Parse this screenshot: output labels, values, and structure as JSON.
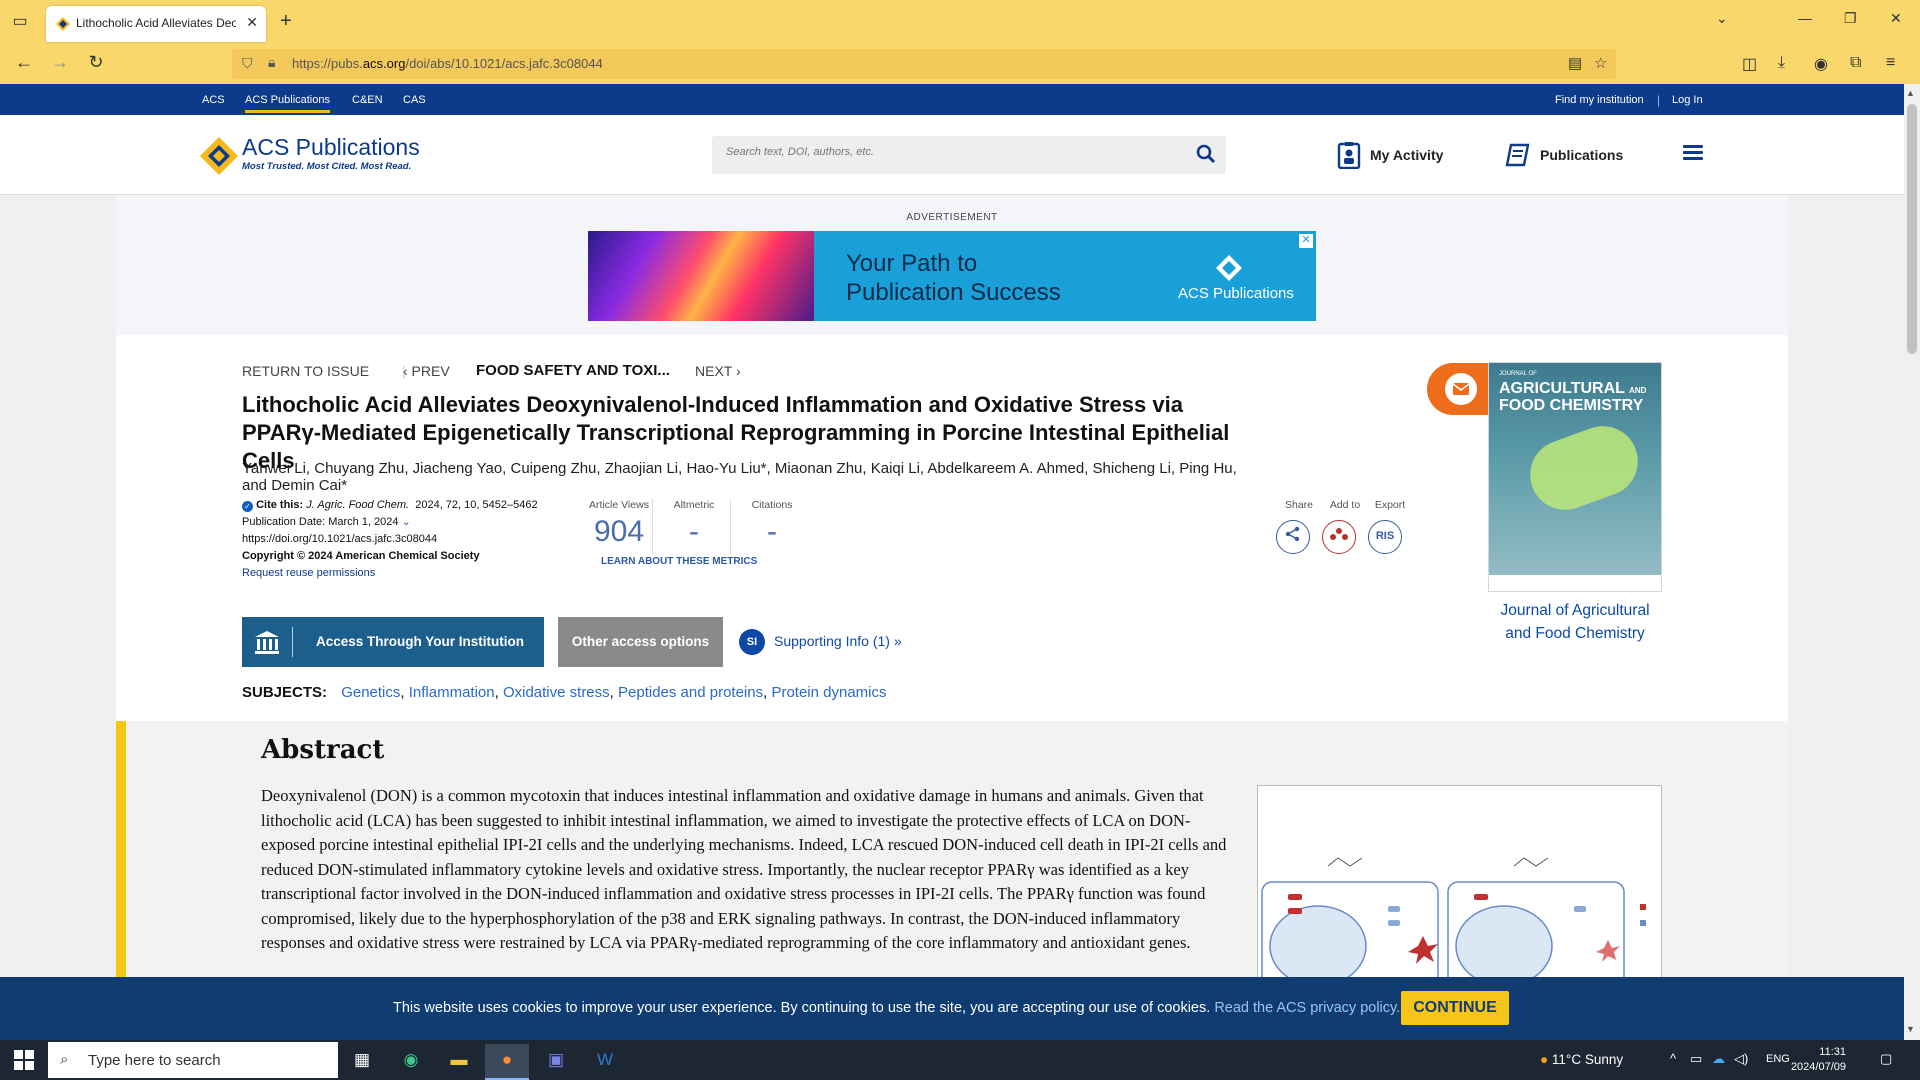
{
  "browser": {
    "tab_title": "Lithocholic Acid Alleviates Deo",
    "url_prefix": "https://pubs.",
    "url_domain": "acs.org",
    "url_rest": "/doi/abs/10.1021/acs.jafc.3c08044"
  },
  "sitebar": {
    "links": [
      "ACS",
      "ACS Publications",
      "C&EN",
      "CAS"
    ],
    "find_institution": "Find my institution",
    "separator": "|",
    "login": "Log In"
  },
  "header": {
    "logo_text": "ACS Publications",
    "logo_tagline": "Most Trusted. Most Cited. Most Read.",
    "search_placeholder": "Search text, DOI, authors, etc.",
    "my_activity": "My Activity",
    "publications": "Publications"
  },
  "ad": {
    "label": "ADVERTISEMENT",
    "headline_1": "Your Path to",
    "headline_2": "Publication Success",
    "brand": "ACS Publications",
    "close": "✕"
  },
  "nav": {
    "return_to_issue": "RETURN TO ISSUE",
    "prev": "‹ PREV",
    "journal": "FOOD SAFETY AND TOXI...",
    "next": "NEXT ›"
  },
  "article": {
    "title": "Lithocholic Acid Alleviates Deoxynivalenol-Induced Inflammation and Oxidative Stress via PPARγ-Mediated Epigenetically Transcriptional Reprogramming in Porcine Intestinal Epithelial Cells",
    "authors": "Yanwei Li, Chuyang Zhu, Jiacheng Yao, Cuipeng Zhu, Zhaojian Li, Hao-Yu Liu*, Miaonan Zhu, Kaiqi Li, Abdelkareem A. Ahmed, Shicheng Li, Ping Hu, and Demin Cai*",
    "cite_label": "Cite this:",
    "cite_journal": "J. Agric. Food Chem.",
    "cite_rest": "2024, 72, 10, 5452–5462",
    "pub_date": "Publication Date: March 1, 2024",
    "doi": "https://doi.org/10.1021/acs.jafc.3c08044",
    "copyright": "Copyright © 2024 American Chemical Society",
    "reuse": "Request reuse permissions"
  },
  "metrics": {
    "views_label": "Article Views",
    "views": "904",
    "altmetric_label": "Altmetric",
    "altmetric": "-",
    "citations_label": "Citations",
    "citations": "-",
    "learn": "LEARN ABOUT THESE METRICS"
  },
  "actions": {
    "share": "Share",
    "add_to": "Add to",
    "export": "Export",
    "ris": "RIS"
  },
  "access": {
    "institution": "Access Through Your Institution",
    "other": "Other access options",
    "si_badge": "SI",
    "supporting": "Supporting Info (1) »"
  },
  "subjects": {
    "label": "SUBJECTS:",
    "items": [
      "Genetics",
      "Inflammation",
      "Oxidative stress",
      "Peptides and proteins",
      "Protein dynamics"
    ]
  },
  "cover": {
    "journal_small": "JOURNAL OF",
    "cover_title_1": "AGRICULTURAL",
    "cover_title_and": "AND",
    "cover_title_2": "FOOD CHEMISTRY",
    "caption": "Journal of Agricultural and Food Chemistry"
  },
  "abstract": {
    "heading": "Abstract",
    "text": "Deoxynivalenol (DON) is a common mycotoxin that induces intestinal inflammation and oxidative damage in humans and animals. Given that lithocholic acid (LCA) has been suggested to inhibit intestinal inflammation, we aimed to investigate the protective effects of LCA on DON-exposed porcine intestinal epithelial IPI-2I cells and the underlying mechanisms. Indeed, LCA rescued DON-induced cell death in IPI-2I cells and reduced DON-stimulated inflammatory cytokine levels and oxidative stress. Importantly, the nuclear receptor PPARγ was identified as a key transcriptional factor involved in the DON-induced inflammation and oxidative stress processes in IPI-2I cells. The PPARγ function was found compromised, likely due to the hyperphosphorylation of the p38 and ERK signaling pathways. In contrast, the DON-induced inflammatory responses and oxidative stress were restrained by LCA via PPARγ-mediated reprogramming of the core inflammatory and antioxidant genes."
  },
  "cookie": {
    "message": "This website uses cookies to improve your user experience. By continuing to use the site, you are accepting our use of cookies.",
    "link": "Read the ACS privacy policy.",
    "continue": "CONTINUE"
  },
  "taskbar": {
    "search_placeholder": "Type here to search",
    "weather": "11°C  Sunny",
    "lang": "ENG",
    "time": "11:31",
    "date": "2024/07/09"
  },
  "colors": {
    "chrome": "#f9d76a",
    "acs_blue": "#0d3a8a",
    "accent_yellow": "#f6c517",
    "cookie_bg": "#0f3d72"
  }
}
